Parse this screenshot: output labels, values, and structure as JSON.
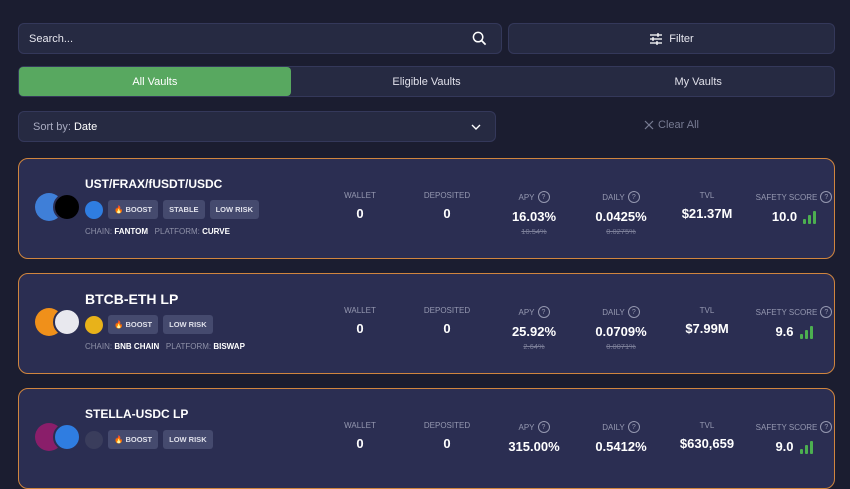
{
  "search": {
    "placeholder": "Search..."
  },
  "filter_label": "Filter",
  "tabs": [
    "All Vaults",
    "Eligible Vaults",
    "My Vaults"
  ],
  "sort": {
    "label": "Sort by:",
    "value": "Date"
  },
  "clear_all": "Clear All",
  "labels": {
    "wallet": "WALLET",
    "deposited": "DEPOSITED",
    "apy": "APY",
    "daily": "DAILY",
    "tvl": "TVL",
    "safety": "SAFETY SCORE",
    "chain": "CHAIN:",
    "platform": "PLATFORM:",
    "help": "?"
  },
  "vaults": [
    {
      "name": "UST/FRAX/fUSDT/USDC",
      "tags": [
        "BOOST",
        "STABLE",
        "LOW RISK"
      ],
      "chain": "FANTOM",
      "platform": "CURVE",
      "wallet": "0",
      "deposited": "0",
      "apy": "16.03%",
      "apy_old": "10.54%",
      "daily": "0.0425%",
      "daily_old": "0.0275%",
      "tvl": "$21.37M",
      "safety": "10.0"
    },
    {
      "name": "BTCB-ETH LP",
      "tags": [
        "BOOST",
        "LOW RISK"
      ],
      "chain": "BNB CHAIN",
      "platform": "BISWAP",
      "wallet": "0",
      "deposited": "0",
      "apy": "25.92%",
      "apy_old": "2.64%",
      "daily": "0.0709%",
      "daily_old": "0.0071%",
      "tvl": "$7.99M",
      "safety": "9.6"
    },
    {
      "name": "STELLA-USDC LP",
      "tags": [
        "BOOST",
        "LOW RISK"
      ],
      "wallet": "0",
      "deposited": "0",
      "apy": "315.00%",
      "daily": "0.5412%",
      "tvl": "$630,659",
      "safety": "9.0"
    }
  ]
}
